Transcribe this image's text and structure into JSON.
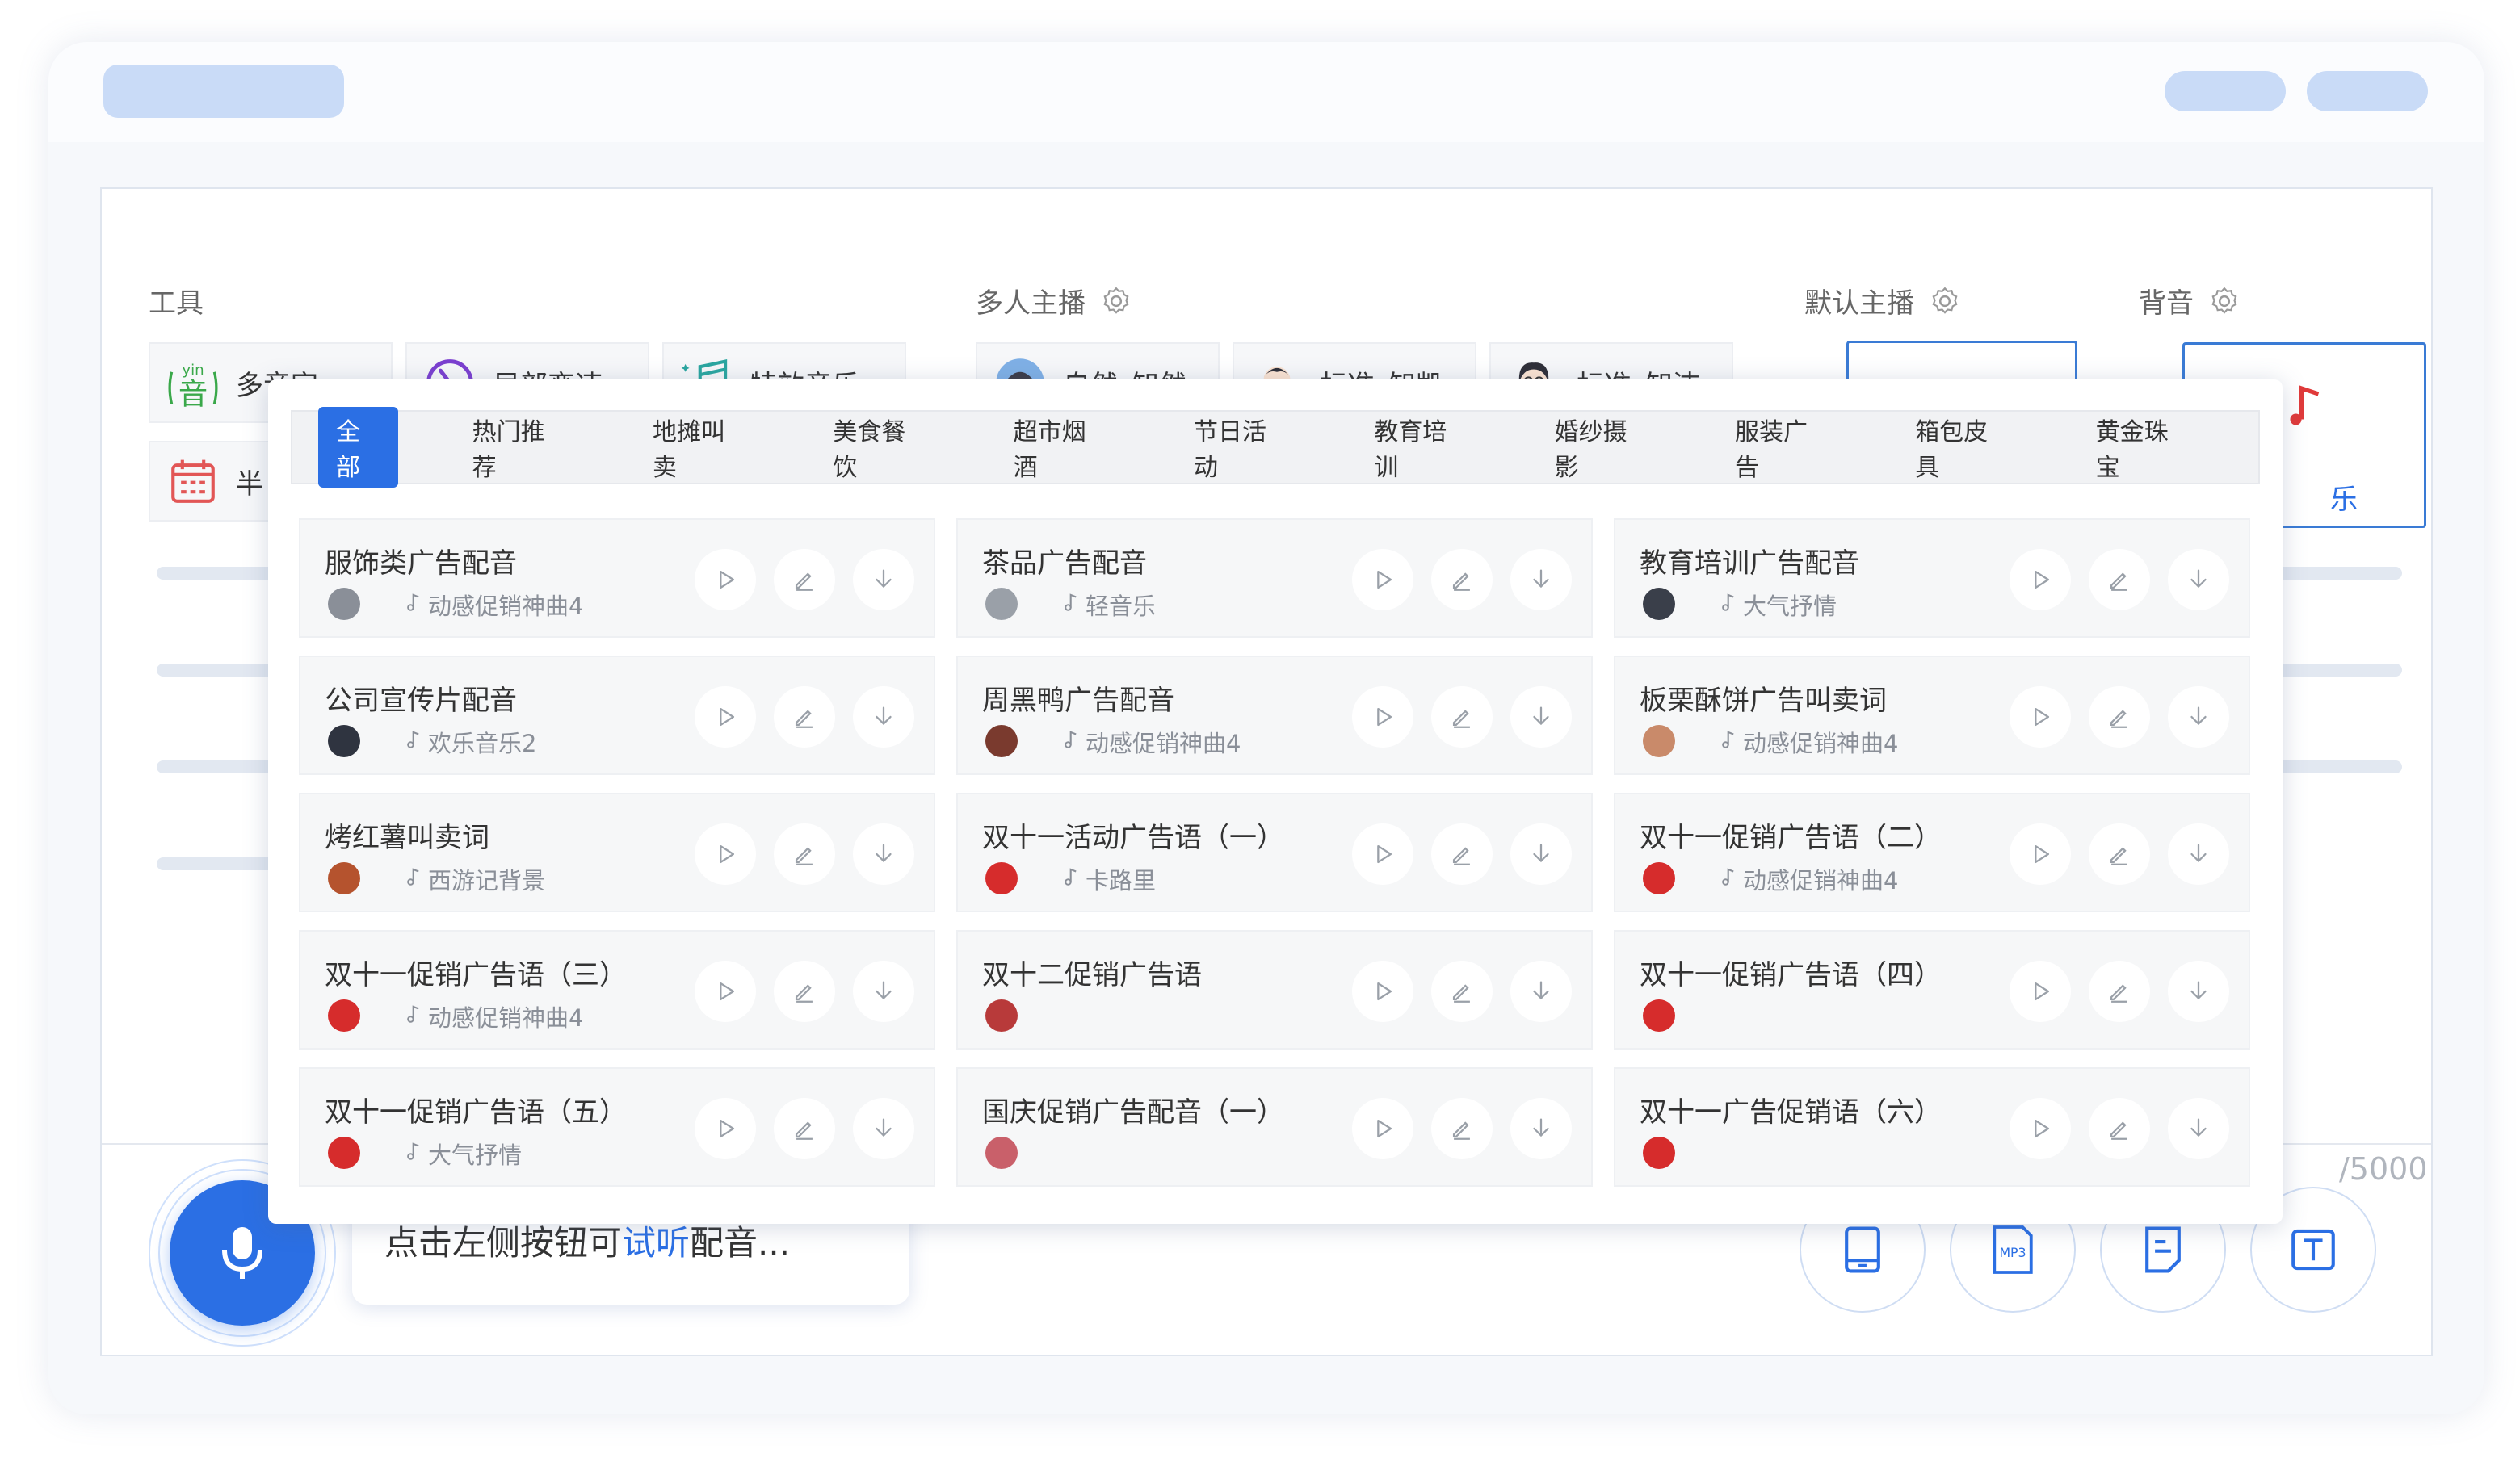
{
  "sections": {
    "tools": "工具",
    "multi_anchor": "多人主播",
    "default_anchor": "默认主播",
    "bgm": "背音"
  },
  "tools": [
    {
      "label": "多音字",
      "icon": "yin-icon"
    },
    {
      "label": "局部变速",
      "icon": "speed-dial-icon"
    },
    {
      "label": "特效音乐",
      "icon": "music-notes-icon"
    }
  ],
  "anchors": [
    {
      "label": "自然–知然",
      "icon": "avatar-icon"
    },
    {
      "label": "标准–知凯",
      "icon": "avatar-icon"
    },
    {
      "label": "标准–知洁",
      "icon": "avatar-icon"
    }
  ],
  "bgm_partial": "乐",
  "row2_partial": "半",
  "counter": "/5000",
  "hint": {
    "prefix": "点击左侧按钮可",
    "link": "试听",
    "suffix": "配音..."
  },
  "bottom_buttons": [
    {
      "icon": "tablet-icon"
    },
    {
      "icon": "mp3-icon",
      "label": "MP3"
    },
    {
      "icon": "document-icon"
    },
    {
      "icon": "text-icon"
    }
  ],
  "popup": {
    "tabs": [
      "全部",
      "热门推荐",
      "地摊叫卖",
      "美食餐饮",
      "超市烟酒",
      "节日活动",
      "教育培训",
      "婚纱摄影",
      "服装广告",
      "箱包皮具",
      "黄金珠宝"
    ],
    "active_tab": 0,
    "cards": [
      {
        "title": "服饰类广告配音",
        "music": "动感促销神曲4",
        "avatar": "#8a8f98"
      },
      {
        "title": "茶品广告配音",
        "music": "轻音乐",
        "avatar": "#9aa0a8"
      },
      {
        "title": "教育培训广告配音",
        "music": "大气抒情",
        "avatar": "#3a3f4a"
      },
      {
        "title": "公司宣传片配音",
        "music": "欢乐音乐2",
        "avatar": "#2f3440"
      },
      {
        "title": "周黑鸭广告配音",
        "music": "动感促销神曲4",
        "avatar": "#7a3a2e"
      },
      {
        "title": "板栗酥饼广告叫卖词",
        "music": "动感促销神曲4",
        "avatar": "#c98a6a"
      },
      {
        "title": "烤红薯叫卖词",
        "music": "西游记背景",
        "avatar": "#b5532e"
      },
      {
        "title": "双十一活动广告语（一）",
        "music": "卡路里",
        "avatar": "#d62c2c"
      },
      {
        "title": "双十一促销广告语（二）",
        "music": "动感促销神曲4",
        "avatar": "#d62c2c"
      },
      {
        "title": "双十一促销广告语（三）",
        "music": "动感促销神曲4",
        "avatar": "#d62c2c"
      },
      {
        "title": "双十二促销广告语",
        "music": "",
        "avatar": "#b83a3a"
      },
      {
        "title": "双十一促销广告语（四）",
        "music": "",
        "avatar": "#d62c2c"
      },
      {
        "title": "双十一促销广告语（五）",
        "music": "大气抒情",
        "avatar": "#d62c2c"
      },
      {
        "title": "国庆促销广告配音（一）",
        "music": "",
        "avatar": "#c9606a"
      },
      {
        "title": "双十一广告促销语（六）",
        "music": "",
        "avatar": "#d62c2c"
      }
    ]
  },
  "colors": {
    "accent": "#2b6fe4",
    "pill": "#c9dbf7"
  }
}
